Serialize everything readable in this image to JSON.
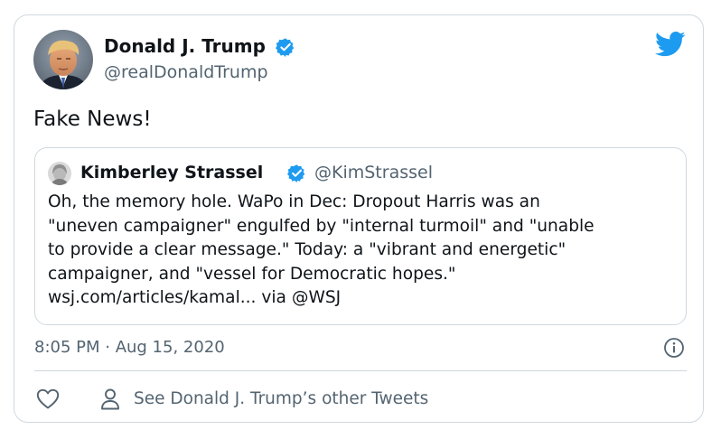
{
  "author": {
    "name": "Donald J. Trump",
    "handle": "@realDonaldTrump",
    "verified": true
  },
  "tweet": {
    "text": "Fake News!"
  },
  "quoted_tweet": {
    "author_name": "Kimberley Strassel",
    "author_handle": "@KimStrassel",
    "verified": true,
    "text_lines": [
      "Oh, the memory hole. WaPo in Dec: Dropout Harris was an",
      "\"uneven campaigner\" engulfed by \"internal turmoil\" and \"unable",
      "to provide a clear message.\" Today: a \"vibrant and energetic\"",
      "campaigner, and \"vessel for Democratic hopes.\"",
      "wsj.com/articles/kamal... via @WSJ"
    ]
  },
  "meta": {
    "timestamp": "8:05 PM · Aug 15, 2020"
  },
  "actions": {
    "other_tweets_label": "See Donald J. Trump’s other Tweets"
  },
  "icons": {
    "like": "heart-icon",
    "profile": "person-icon",
    "info": "info-icon",
    "brand": "twitter-bird-icon",
    "verified": "verified-badge-icon"
  },
  "colors": {
    "brand_blue": "#1d9bf0",
    "text_primary": "#0f1419",
    "text_secondary": "#536471",
    "border": "#cfd9de"
  }
}
